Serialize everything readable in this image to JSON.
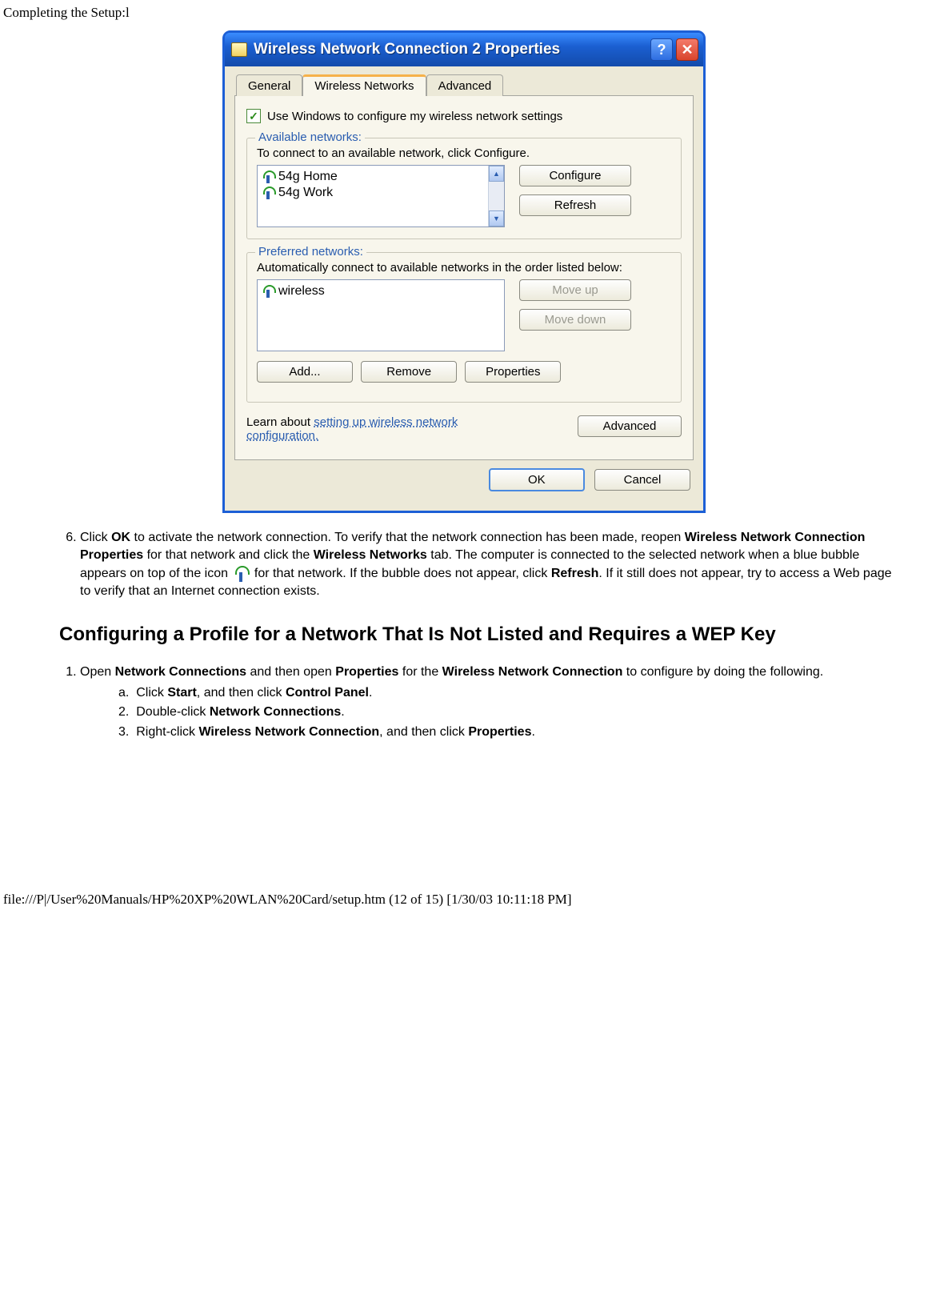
{
  "header": "Completing the Setup:l",
  "dialog": {
    "title": "Wireless Network Connection 2 Properties",
    "tabs": {
      "general": "General",
      "wireless": "Wireless Networks",
      "advanced": "Advanced"
    },
    "use_windows": "Use Windows to configure my wireless network settings",
    "available": {
      "legend": "Available networks:",
      "hint": "To connect to an available network, click Configure.",
      "items": [
        "54g Home",
        "54g Work"
      ],
      "configure": "Configure",
      "refresh": "Refresh"
    },
    "preferred": {
      "legend": "Preferred networks:",
      "hint": "Automatically connect to available networks in the order listed below:",
      "items": [
        "wireless"
      ],
      "moveup": "Move up",
      "movedown": "Move down",
      "add": "Add...",
      "remove": "Remove",
      "properties": "Properties"
    },
    "learn_prefix": "Learn about ",
    "learn_link": "setting up wireless network configuration.",
    "adv_btn": "Advanced",
    "ok": "OK",
    "cancel": "Cancel"
  },
  "step6": {
    "num": "6.",
    "t1": "Click ",
    "b1": "OK",
    "t2": " to activate the network connection. To verify that the network connection has been made, reopen ",
    "b2": "Wireless Network Connection Properties",
    "t3": " for that network and click the ",
    "b3": "Wireless Networks",
    "t4": " tab. The computer is connected to the selected network when a blue bubble appears on top of the icon ",
    "t5": " for that network. If the bubble does not appear, click ",
    "b4": "Refresh",
    "t6": ". If it still does not appear, try to access a Web page to verify that an Internet connection exists."
  },
  "section_head": "Configuring a Profile for a Network That Is Not Listed and Requires a WEP Key",
  "step1": {
    "num": "1.",
    "t1": "Open ",
    "b1": "Network Connections",
    "t2": " and then open ",
    "b2": "Properties",
    "t3": " for the ",
    "b3": "Wireless Network Connection",
    "t4": " to configure by doing the following.",
    "sub": {
      "a": {
        "m": "a.",
        "t1": "Click ",
        "b1": "Start",
        "t2": ", and then click ",
        "b2": "Control Panel",
        "t3": "."
      },
      "s2": {
        "m": "2.",
        "t1": "Double-click ",
        "b1": "Network Connections",
        "t2": "."
      },
      "s3": {
        "m": "3.",
        "t1": "Right-click ",
        "b1": "Wireless Network Connection",
        "t2": ", and then click ",
        "b2": "Properties",
        "t3": "."
      }
    }
  },
  "footer": "file:///P|/User%20Manuals/HP%20XP%20WLAN%20Card/setup.htm (12 of 15) [1/30/03 10:11:18 PM]"
}
